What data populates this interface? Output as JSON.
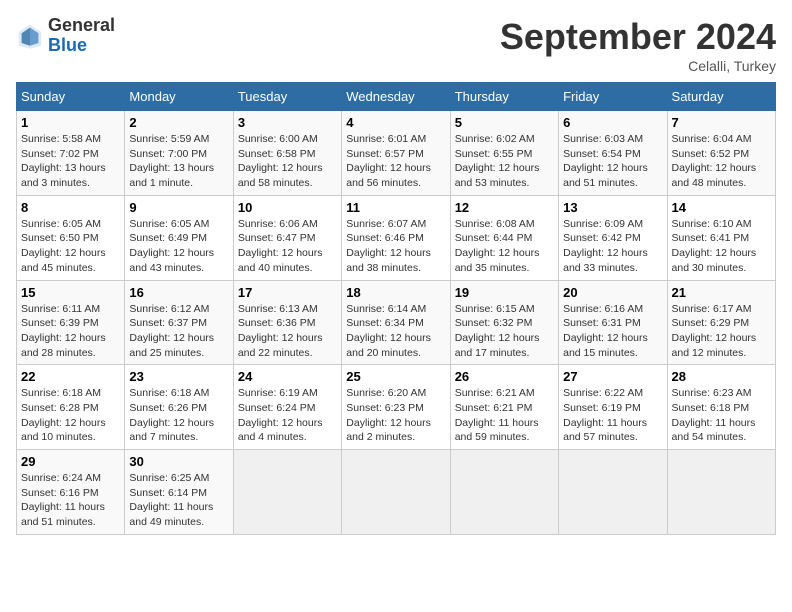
{
  "header": {
    "logo_general": "General",
    "logo_blue": "Blue",
    "month_title": "September 2024",
    "location": "Celalli, Turkey"
  },
  "weekdays": [
    "Sunday",
    "Monday",
    "Tuesday",
    "Wednesday",
    "Thursday",
    "Friday",
    "Saturday"
  ],
  "weeks": [
    [
      {
        "day": "1",
        "lines": [
          "Sunrise: 5:58 AM",
          "Sunset: 7:02 PM",
          "Daylight: 13 hours",
          "and 3 minutes."
        ]
      },
      {
        "day": "2",
        "lines": [
          "Sunrise: 5:59 AM",
          "Sunset: 7:00 PM",
          "Daylight: 13 hours",
          "and 1 minute."
        ]
      },
      {
        "day": "3",
        "lines": [
          "Sunrise: 6:00 AM",
          "Sunset: 6:58 PM",
          "Daylight: 12 hours",
          "and 58 minutes."
        ]
      },
      {
        "day": "4",
        "lines": [
          "Sunrise: 6:01 AM",
          "Sunset: 6:57 PM",
          "Daylight: 12 hours",
          "and 56 minutes."
        ]
      },
      {
        "day": "5",
        "lines": [
          "Sunrise: 6:02 AM",
          "Sunset: 6:55 PM",
          "Daylight: 12 hours",
          "and 53 minutes."
        ]
      },
      {
        "day": "6",
        "lines": [
          "Sunrise: 6:03 AM",
          "Sunset: 6:54 PM",
          "Daylight: 12 hours",
          "and 51 minutes."
        ]
      },
      {
        "day": "7",
        "lines": [
          "Sunrise: 6:04 AM",
          "Sunset: 6:52 PM",
          "Daylight: 12 hours",
          "and 48 minutes."
        ]
      }
    ],
    [
      {
        "day": "8",
        "lines": [
          "Sunrise: 6:05 AM",
          "Sunset: 6:50 PM",
          "Daylight: 12 hours",
          "and 45 minutes."
        ]
      },
      {
        "day": "9",
        "lines": [
          "Sunrise: 6:05 AM",
          "Sunset: 6:49 PM",
          "Daylight: 12 hours",
          "and 43 minutes."
        ]
      },
      {
        "day": "10",
        "lines": [
          "Sunrise: 6:06 AM",
          "Sunset: 6:47 PM",
          "Daylight: 12 hours",
          "and 40 minutes."
        ]
      },
      {
        "day": "11",
        "lines": [
          "Sunrise: 6:07 AM",
          "Sunset: 6:46 PM",
          "Daylight: 12 hours",
          "and 38 minutes."
        ]
      },
      {
        "day": "12",
        "lines": [
          "Sunrise: 6:08 AM",
          "Sunset: 6:44 PM",
          "Daylight: 12 hours",
          "and 35 minutes."
        ]
      },
      {
        "day": "13",
        "lines": [
          "Sunrise: 6:09 AM",
          "Sunset: 6:42 PM",
          "Daylight: 12 hours",
          "and 33 minutes."
        ]
      },
      {
        "day": "14",
        "lines": [
          "Sunrise: 6:10 AM",
          "Sunset: 6:41 PM",
          "Daylight: 12 hours",
          "and 30 minutes."
        ]
      }
    ],
    [
      {
        "day": "15",
        "lines": [
          "Sunrise: 6:11 AM",
          "Sunset: 6:39 PM",
          "Daylight: 12 hours",
          "and 28 minutes."
        ]
      },
      {
        "day": "16",
        "lines": [
          "Sunrise: 6:12 AM",
          "Sunset: 6:37 PM",
          "Daylight: 12 hours",
          "and 25 minutes."
        ]
      },
      {
        "day": "17",
        "lines": [
          "Sunrise: 6:13 AM",
          "Sunset: 6:36 PM",
          "Daylight: 12 hours",
          "and 22 minutes."
        ]
      },
      {
        "day": "18",
        "lines": [
          "Sunrise: 6:14 AM",
          "Sunset: 6:34 PM",
          "Daylight: 12 hours",
          "and 20 minutes."
        ]
      },
      {
        "day": "19",
        "lines": [
          "Sunrise: 6:15 AM",
          "Sunset: 6:32 PM",
          "Daylight: 12 hours",
          "and 17 minutes."
        ]
      },
      {
        "day": "20",
        "lines": [
          "Sunrise: 6:16 AM",
          "Sunset: 6:31 PM",
          "Daylight: 12 hours",
          "and 15 minutes."
        ]
      },
      {
        "day": "21",
        "lines": [
          "Sunrise: 6:17 AM",
          "Sunset: 6:29 PM",
          "Daylight: 12 hours",
          "and 12 minutes."
        ]
      }
    ],
    [
      {
        "day": "22",
        "lines": [
          "Sunrise: 6:18 AM",
          "Sunset: 6:28 PM",
          "Daylight: 12 hours",
          "and 10 minutes."
        ]
      },
      {
        "day": "23",
        "lines": [
          "Sunrise: 6:18 AM",
          "Sunset: 6:26 PM",
          "Daylight: 12 hours",
          "and 7 minutes."
        ]
      },
      {
        "day": "24",
        "lines": [
          "Sunrise: 6:19 AM",
          "Sunset: 6:24 PM",
          "Daylight: 12 hours",
          "and 4 minutes."
        ]
      },
      {
        "day": "25",
        "lines": [
          "Sunrise: 6:20 AM",
          "Sunset: 6:23 PM",
          "Daylight: 12 hours",
          "and 2 minutes."
        ]
      },
      {
        "day": "26",
        "lines": [
          "Sunrise: 6:21 AM",
          "Sunset: 6:21 PM",
          "Daylight: 11 hours",
          "and 59 minutes."
        ]
      },
      {
        "day": "27",
        "lines": [
          "Sunrise: 6:22 AM",
          "Sunset: 6:19 PM",
          "Daylight: 11 hours",
          "and 57 minutes."
        ]
      },
      {
        "day": "28",
        "lines": [
          "Sunrise: 6:23 AM",
          "Sunset: 6:18 PM",
          "Daylight: 11 hours",
          "and 54 minutes."
        ]
      }
    ],
    [
      {
        "day": "29",
        "lines": [
          "Sunrise: 6:24 AM",
          "Sunset: 6:16 PM",
          "Daylight: 11 hours",
          "and 51 minutes."
        ]
      },
      {
        "day": "30",
        "lines": [
          "Sunrise: 6:25 AM",
          "Sunset: 6:14 PM",
          "Daylight: 11 hours",
          "and 49 minutes."
        ]
      },
      null,
      null,
      null,
      null,
      null
    ]
  ]
}
